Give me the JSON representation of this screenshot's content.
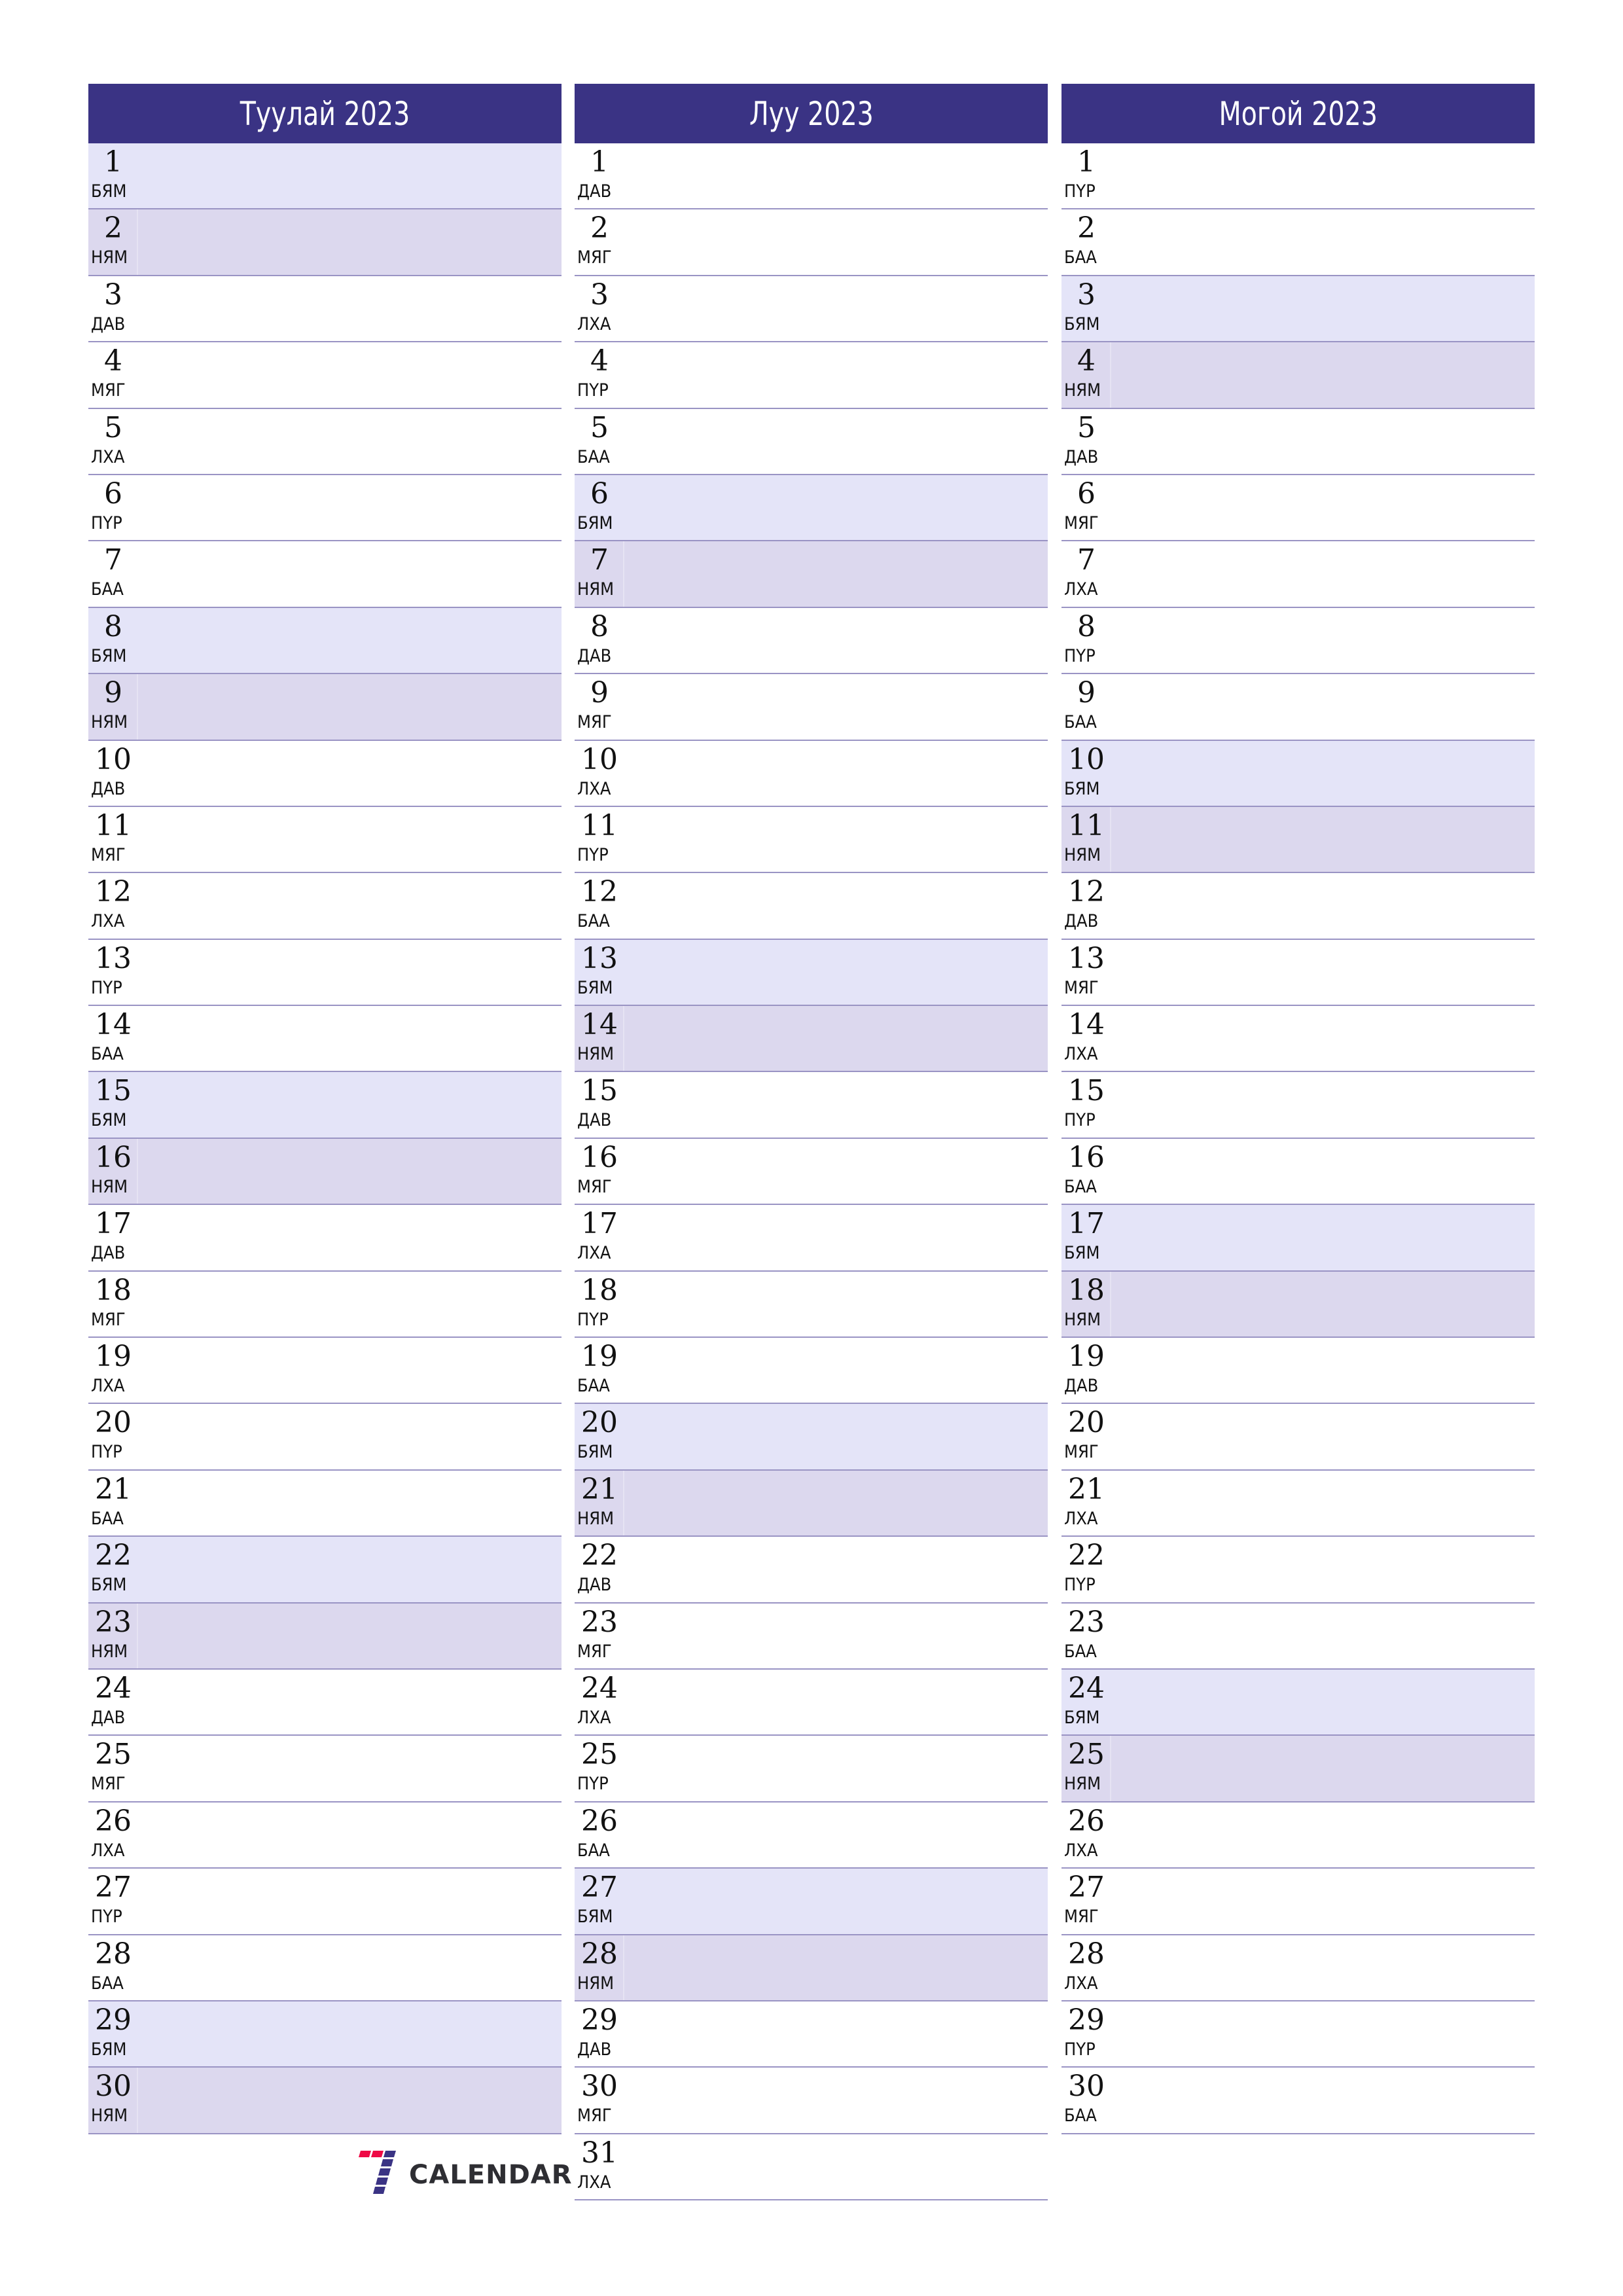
{
  "colors": {
    "header_bg": "#3a3384",
    "saturday_bg": "#e4e4f8",
    "sunday_bg": "#dcd8ee",
    "divider": "#9a94c4",
    "logo_red": "#ee0a45",
    "logo_blue": "#3a3384"
  },
  "weekday_names": {
    "mon": "ДАВ",
    "tue": "МЯГ",
    "wed": "ЛХА",
    "thu": "ПҮР",
    "fri": "БАА",
    "sat": "БЯМ",
    "sun": "НЯМ"
  },
  "months": [
    {
      "title": "Туулай 2023",
      "days": [
        {
          "n": "1",
          "w": "БЯМ"
        },
        {
          "n": "2",
          "w": "НЯМ"
        },
        {
          "n": "3",
          "w": "ДАВ"
        },
        {
          "n": "4",
          "w": "МЯГ"
        },
        {
          "n": "5",
          "w": "ЛХА"
        },
        {
          "n": "6",
          "w": "ПҮР"
        },
        {
          "n": "7",
          "w": "БАА"
        },
        {
          "n": "8",
          "w": "БЯМ"
        },
        {
          "n": "9",
          "w": "НЯМ"
        },
        {
          "n": "10",
          "w": "ДАВ"
        },
        {
          "n": "11",
          "w": "МЯГ"
        },
        {
          "n": "12",
          "w": "ЛХА"
        },
        {
          "n": "13",
          "w": "ПҮР"
        },
        {
          "n": "14",
          "w": "БАА"
        },
        {
          "n": "15",
          "w": "БЯМ"
        },
        {
          "n": "16",
          "w": "НЯМ"
        },
        {
          "n": "17",
          "w": "ДАВ"
        },
        {
          "n": "18",
          "w": "МЯГ"
        },
        {
          "n": "19",
          "w": "ЛХА"
        },
        {
          "n": "20",
          "w": "ПҮР"
        },
        {
          "n": "21",
          "w": "БАА"
        },
        {
          "n": "22",
          "w": "БЯМ"
        },
        {
          "n": "23",
          "w": "НЯМ"
        },
        {
          "n": "24",
          "w": "ДАВ"
        },
        {
          "n": "25",
          "w": "МЯГ"
        },
        {
          "n": "26",
          "w": "ЛХА"
        },
        {
          "n": "27",
          "w": "ПҮР"
        },
        {
          "n": "28",
          "w": "БАА"
        },
        {
          "n": "29",
          "w": "БЯМ"
        },
        {
          "n": "30",
          "w": "НЯМ"
        }
      ]
    },
    {
      "title": "Луу 2023",
      "days": [
        {
          "n": "1",
          "w": "ДАВ"
        },
        {
          "n": "2",
          "w": "МЯГ"
        },
        {
          "n": "3",
          "w": "ЛХА"
        },
        {
          "n": "4",
          "w": "ПҮР"
        },
        {
          "n": "5",
          "w": "БАА"
        },
        {
          "n": "6",
          "w": "БЯМ"
        },
        {
          "n": "7",
          "w": "НЯМ"
        },
        {
          "n": "8",
          "w": "ДАВ"
        },
        {
          "n": "9",
          "w": "МЯГ"
        },
        {
          "n": "10",
          "w": "ЛХА"
        },
        {
          "n": "11",
          "w": "ПҮР"
        },
        {
          "n": "12",
          "w": "БАА"
        },
        {
          "n": "13",
          "w": "БЯМ"
        },
        {
          "n": "14",
          "w": "НЯМ"
        },
        {
          "n": "15",
          "w": "ДАВ"
        },
        {
          "n": "16",
          "w": "МЯГ"
        },
        {
          "n": "17",
          "w": "ЛХА"
        },
        {
          "n": "18",
          "w": "ПҮР"
        },
        {
          "n": "19",
          "w": "БАА"
        },
        {
          "n": "20",
          "w": "БЯМ"
        },
        {
          "n": "21",
          "w": "НЯМ"
        },
        {
          "n": "22",
          "w": "ДАВ"
        },
        {
          "n": "23",
          "w": "МЯГ"
        },
        {
          "n": "24",
          "w": "ЛХА"
        },
        {
          "n": "25",
          "w": "ПҮР"
        },
        {
          "n": "26",
          "w": "БАА"
        },
        {
          "n": "27",
          "w": "БЯМ"
        },
        {
          "n": "28",
          "w": "НЯМ"
        },
        {
          "n": "29",
          "w": "ДАВ"
        },
        {
          "n": "30",
          "w": "МЯГ"
        },
        {
          "n": "31",
          "w": "ЛХА"
        }
      ]
    },
    {
      "title": "Могой 2023",
      "days": [
        {
          "n": "1",
          "w": "ПҮР"
        },
        {
          "n": "2",
          "w": "БАА"
        },
        {
          "n": "3",
          "w": "БЯМ"
        },
        {
          "n": "4",
          "w": "НЯМ"
        },
        {
          "n": "5",
          "w": "ДАВ"
        },
        {
          "n": "6",
          "w": "МЯГ"
        },
        {
          "n": "7",
          "w": "ЛХА"
        },
        {
          "n": "8",
          "w": "ПҮР"
        },
        {
          "n": "9",
          "w": "БАА"
        },
        {
          "n": "10",
          "w": "БЯМ"
        },
        {
          "n": "11",
          "w": "НЯМ"
        },
        {
          "n": "12",
          "w": "ДАВ"
        },
        {
          "n": "13",
          "w": "МЯГ"
        },
        {
          "n": "14",
          "w": "ЛХА"
        },
        {
          "n": "15",
          "w": "ПҮР"
        },
        {
          "n": "16",
          "w": "БАА"
        },
        {
          "n": "17",
          "w": "БЯМ"
        },
        {
          "n": "18",
          "w": "НЯМ"
        },
        {
          "n": "19",
          "w": "ДАВ"
        },
        {
          "n": "20",
          "w": "МЯГ"
        },
        {
          "n": "21",
          "w": "ЛХА"
        },
        {
          "n": "22",
          "w": "ПҮР"
        },
        {
          "n": "23",
          "w": "БАА"
        },
        {
          "n": "24",
          "w": "БЯМ"
        },
        {
          "n": "25",
          "w": "НЯМ"
        },
        {
          "n": "26",
          "w": "ЛХА"
        },
        {
          "n": "27",
          "w": "МЯГ"
        },
        {
          "n": "28",
          "w": "ЛХА"
        },
        {
          "n": "29",
          "w": "ПҮР"
        },
        {
          "n": "30",
          "w": "БАА"
        }
      ]
    }
  ],
  "logo": {
    "icon": "seven-calendar-logo-icon",
    "text": "CALENDAR"
  }
}
